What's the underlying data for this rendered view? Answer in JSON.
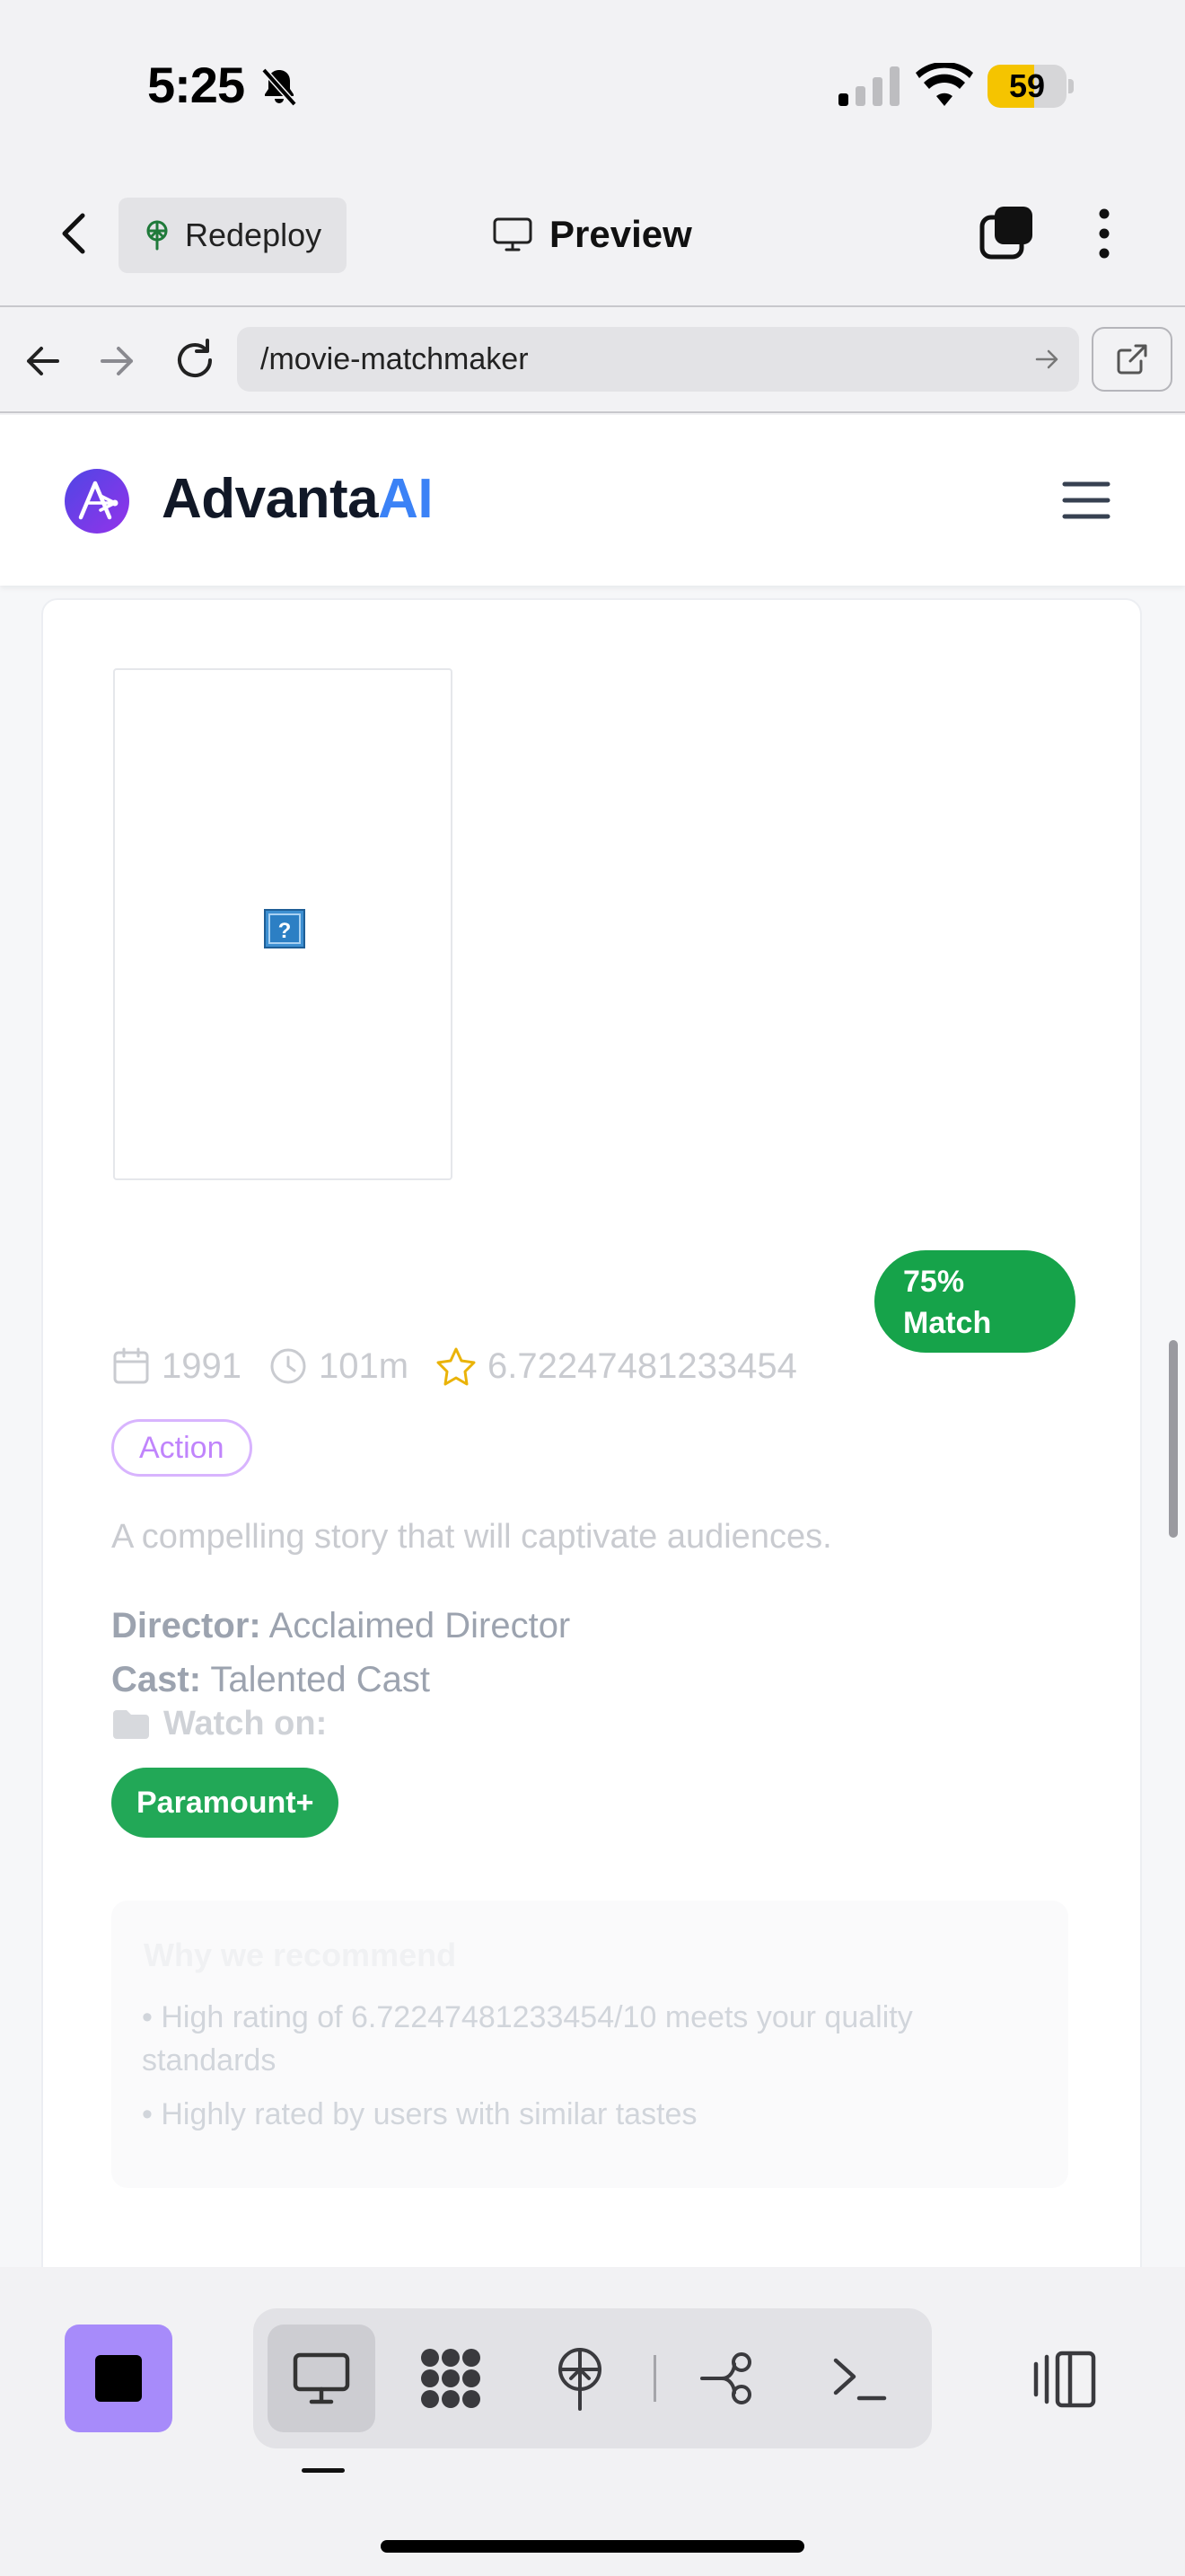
{
  "status_bar": {
    "time": "5:25",
    "battery_percent": "59",
    "battery_level": 0.59,
    "signal_bars_active": 1,
    "icons": [
      "bell-slash-icon",
      "cellular-signal-icon",
      "wifi-icon",
      "battery-icon"
    ]
  },
  "app_bar": {
    "redeploy_label": "Redeploy",
    "title": "Preview",
    "icons": [
      "chevron-left-icon",
      "deploy-icon",
      "monitor-icon",
      "tabs-icon",
      "more-vertical-icon"
    ]
  },
  "browser": {
    "url": "/movie-matchmaker",
    "icons": [
      "arrow-left-icon",
      "arrow-right-icon",
      "reload-icon",
      "go-arrow-icon",
      "external-link-icon"
    ]
  },
  "site": {
    "logo_text": "Advanta",
    "logo_text_accent": "AI",
    "brand_color": "#3b82f6",
    "logo_gradient": [
      "#4f46e5",
      "#9333ea"
    ]
  },
  "movie": {
    "match_percent": "75%",
    "match_label": "Match",
    "year": "1991",
    "runtime": "101m",
    "rating": "6.72247481233454",
    "genre": "Action",
    "description": "A compelling story that will captivate audiences.",
    "director_label": "Director:",
    "director": "Acclaimed Director",
    "cast_label": "Cast:",
    "cast": "Talented Cast",
    "watch_on_label": "Watch on:",
    "provider": "Paramount+",
    "reasons_title": "Why we recommend",
    "reasons": [
      "• High rating of 6.72247481233454/10 meets your quality standards",
      "• Highly rated by users with similar tastes"
    ],
    "match_color": "#16a34a",
    "genre_color": "#c084fc",
    "provider_color": "#22a857"
  },
  "toolbar": {
    "items": [
      "stop-icon",
      "monitor-icon",
      "grid-icon",
      "deploy-icon",
      "git-icon",
      "terminal-icon",
      "panel-toggle-icon"
    ],
    "active": "monitor-icon"
  }
}
